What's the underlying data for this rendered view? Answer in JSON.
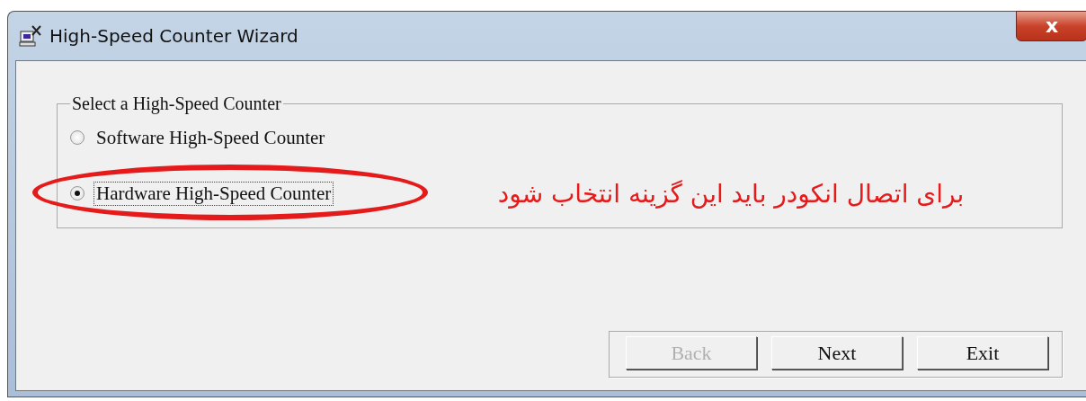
{
  "window": {
    "title": "High-Speed Counter Wizard",
    "close": "x"
  },
  "group": {
    "title": "Select a High-Speed Counter",
    "options": [
      {
        "label": "Software High-Speed Counter",
        "selected": false,
        "focused": false,
        "highlighted": false
      },
      {
        "label": "Hardware High-Speed Counter",
        "selected": true,
        "focused": true,
        "highlighted": true
      }
    ]
  },
  "annotation": "برای اتصال انکودر باید این گزینه انتخاب شود",
  "buttons": [
    {
      "label": "Back",
      "disabled": true
    },
    {
      "label": "Next",
      "disabled": false
    },
    {
      "label": "Exit",
      "disabled": false
    }
  ]
}
